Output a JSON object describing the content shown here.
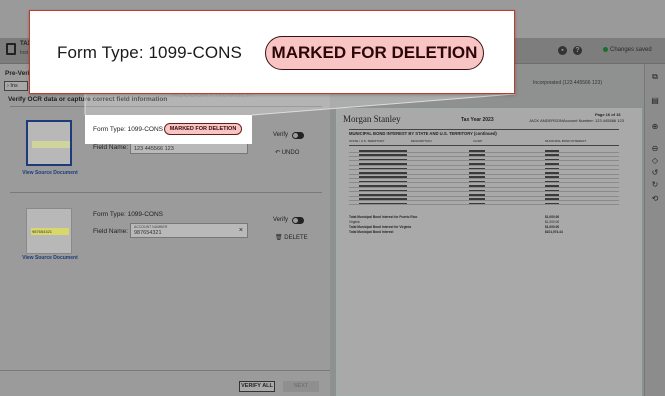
{
  "app": {
    "title": "TAX",
    "subtitle": "Inst"
  },
  "header": {
    "status": "Changes saved"
  },
  "left": {
    "stage_label": "Pre-Verif",
    "tab_label": "Ins",
    "ghost_label": "ACCOUNT NUMBER",
    "section_title": "Verify OCR data or capture correct field information",
    "records": [
      {
        "form_type_label": "Form Type:",
        "form_type_value": "1099-CONS",
        "status_badge": "MARKED FOR DELETION",
        "field_name_label": "Field Name:",
        "field_small_label": "ACCOUNT NUMBER",
        "field_value": "123 445566 123",
        "verify_label": "Verify",
        "action_label": "UNDO",
        "view_source": "View Source Document"
      },
      {
        "form_type_label": "Form Type:",
        "form_type_value": "1099-CONS",
        "field_name_label": "Field Name:",
        "field_small_label": "ACCOUNT NUMBER",
        "field_value": "987654321",
        "snippet_text": "987654321",
        "verify_label": "Verify",
        "action_label": "DELETE",
        "view_source": "View Source Document"
      }
    ],
    "verify_all_label": "VERIFY ALL",
    "next_label": "NEXT"
  },
  "document": {
    "top_note": "Incorporated (123 445566 123)",
    "brand": "Morgan Stanley",
    "tax_year": "Tax Year 2023",
    "page_label": "Page 16 of 16",
    "owner": "JACK ANDERSON",
    "account_label": "Account Number: 123 445566 123",
    "table_title": "MUNICIPAL BOND INTEREST BY STATE AND U.S. TERRITORY (continued)",
    "columns": [
      "STATE / U.S. TERRITORY",
      "DESCRIPTION",
      "CUSIP",
      "MUNICIPAL BOND INTEREST"
    ],
    "totals": [
      {
        "label": "Total Municipal Bond Interest for Puerto Rico",
        "value": "$1,000.00"
      },
      {
        "label": "Virginia",
        "value": "$1,000.00"
      },
      {
        "label": "Total Municipal Bond Interest for Virginia",
        "value": "$1,000.00"
      },
      {
        "label": "Total Municipal Bond Interest",
        "value": "$101,974.44"
      }
    ]
  },
  "callout": {
    "label": "Form Type:  1099-CONS",
    "badge": "MARKED FOR DELETION"
  },
  "colors": {
    "badge_bg": "#f8c5c4",
    "callout_border": "#c0392b",
    "saved_dot": "#1a6f2a"
  }
}
